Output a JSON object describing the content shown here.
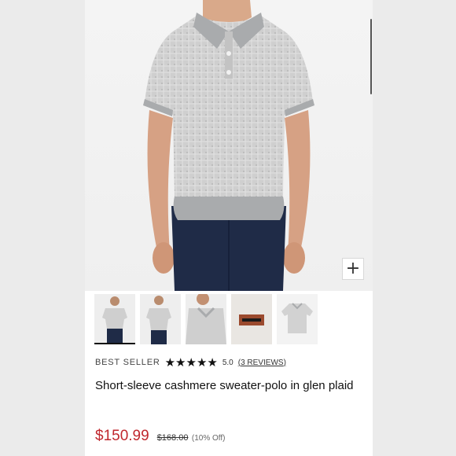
{
  "product": {
    "badge": "BEST SELLER",
    "rating_stars": 5,
    "rating_value": "5.0",
    "reviews_link": "3 REVIEWS",
    "title": "Short-sleeve cashmere sweater-polo in glen plaid",
    "price": "$150.99",
    "original_price": "$168.00",
    "discount": "(10% Off)"
  },
  "gallery": {
    "zoom_label": "+",
    "thumbnails": [
      {
        "name": "front-full"
      },
      {
        "name": "side-view"
      },
      {
        "name": "collar-closeup"
      },
      {
        "name": "label-detail"
      },
      {
        "name": "flat-lay"
      }
    ],
    "active_index": 0
  },
  "colors": {
    "price_red": "#c0272d",
    "sweater_gray": "#c9c9c9",
    "pants_navy": "#1f2b47"
  }
}
